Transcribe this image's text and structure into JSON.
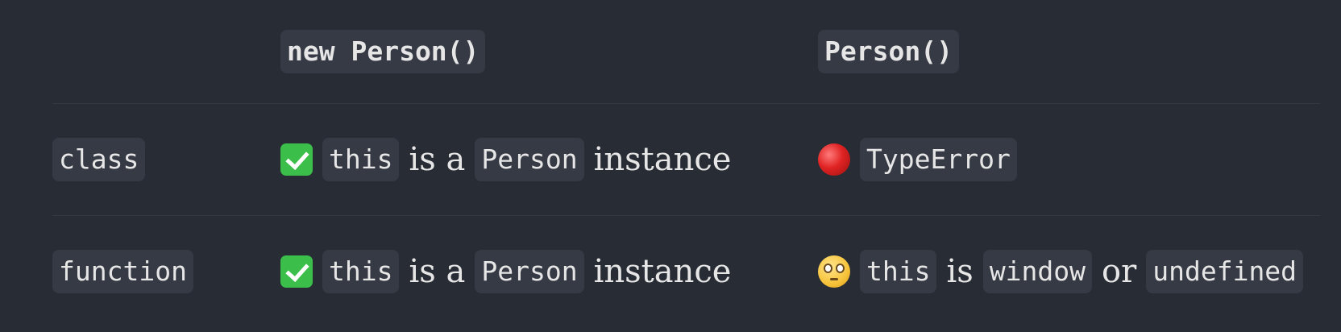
{
  "header": {
    "col_new": "new Person()",
    "col_call": "Person()"
  },
  "rows": [
    {
      "label": "class",
      "new_result": {
        "icon": "check-mark-icon",
        "code1": "this",
        "text1": "is a",
        "code2": "Person",
        "text2": "instance"
      },
      "call_result": {
        "icon": "red-circle-icon",
        "code1": "TypeError"
      }
    },
    {
      "label": "function",
      "new_result": {
        "icon": "check-mark-icon",
        "code1": "this",
        "text1": "is a",
        "code2": "Person",
        "text2": "instance"
      },
      "call_result": {
        "icon": "flushed-face-icon",
        "code1": "this",
        "text1": "is",
        "code2": "window",
        "text2": "or",
        "code3": "undefined"
      }
    }
  ],
  "colors": {
    "background": "#282c34",
    "code_background": "#363a45",
    "text": "#e6e6e6",
    "divider": "#343843",
    "check_green": "#3bbf4a",
    "error_red": "#e02323"
  }
}
